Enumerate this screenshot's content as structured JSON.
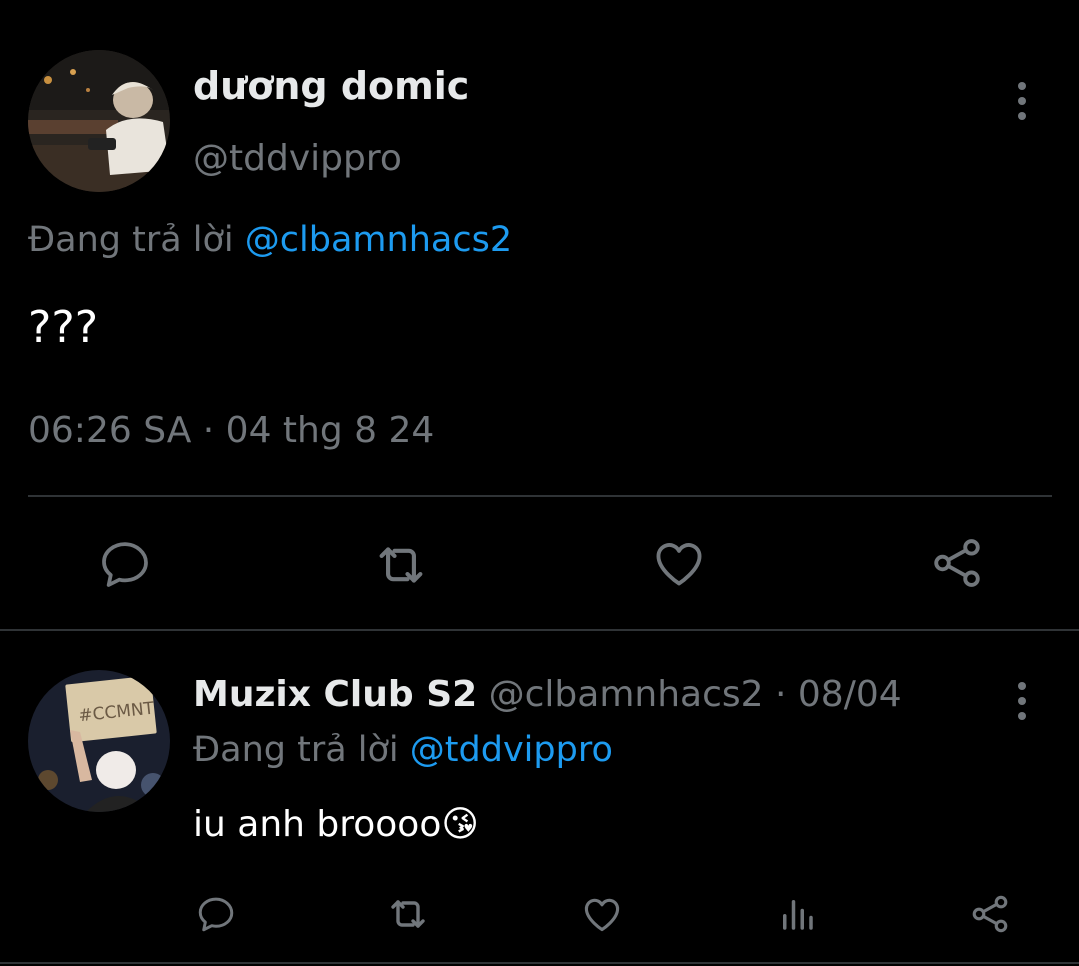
{
  "main_tweet": {
    "display_name": "dương domic",
    "handle": "@tddvippro",
    "reply_prefix": "Đang trả lời",
    "reply_to": "@clbamnhacs2",
    "text": "???",
    "timestamp": "06:26 SA · 04 thg 8 24"
  },
  "reply_tweet": {
    "display_name": "Muzix Club S2",
    "handle": "@clbamnhacs2",
    "separator": "·",
    "date": "08/04",
    "reply_prefix": "Đang trả lời",
    "reply_to": "@tddvippro",
    "text": "iu anh broooo",
    "emoji": "😘",
    "sign_text": "#CCMNT"
  },
  "icons": {
    "reply": "speech-bubble-icon",
    "retweet": "retweet-icon",
    "like": "heart-icon",
    "share": "share-icon",
    "views": "bar-chart-icon",
    "more": "vertical-dots-icon"
  },
  "colors": {
    "background": "#000000",
    "text": "#e7e9ea",
    "muted": "#71767b",
    "link": "#1d9bf0",
    "divider": "#2f3336"
  }
}
